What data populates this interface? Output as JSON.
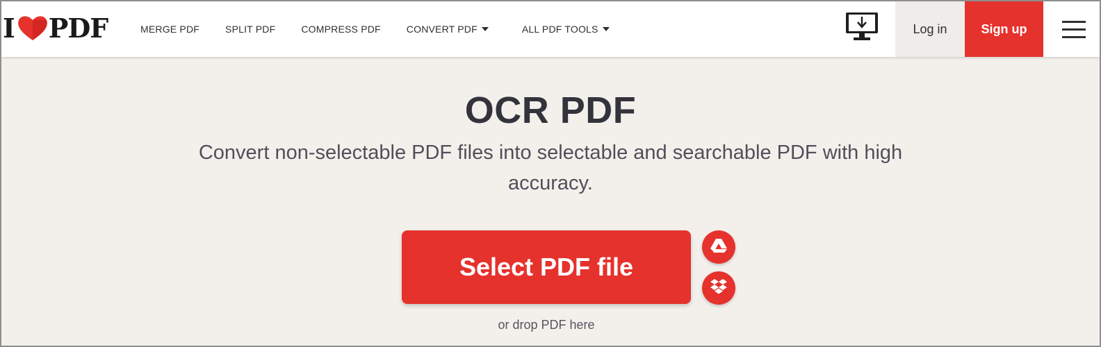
{
  "header": {
    "logo": {
      "text_left": "I",
      "text_right": "PDF",
      "heart_color": "#e5322d"
    },
    "nav": [
      {
        "label": "MERGE PDF",
        "dropdown": false
      },
      {
        "label": "SPLIT PDF",
        "dropdown": false
      },
      {
        "label": "COMPRESS PDF",
        "dropdown": false
      },
      {
        "label": "CONVERT PDF",
        "dropdown": true
      },
      {
        "label": "ALL PDF TOOLS",
        "dropdown": true
      }
    ],
    "desktop_icon": "desktop-download-icon",
    "login_label": "Log in",
    "signup_label": "Sign up",
    "menu_icon": "hamburger-menu-icon"
  },
  "main": {
    "title": "OCR PDF",
    "subtitle": "Convert non-selectable PDF files into selectable and searchable PDF with high accuracy.",
    "select_button_label": "Select PDF file",
    "cloud_buttons": [
      {
        "icon": "google-drive-icon"
      },
      {
        "icon": "dropbox-icon"
      }
    ],
    "drop_hint": "or drop PDF here"
  },
  "colors": {
    "accent": "#e5322d",
    "background": "#f3f0ec",
    "header_bg": "#ffffff",
    "text_dark": "#33333b"
  }
}
